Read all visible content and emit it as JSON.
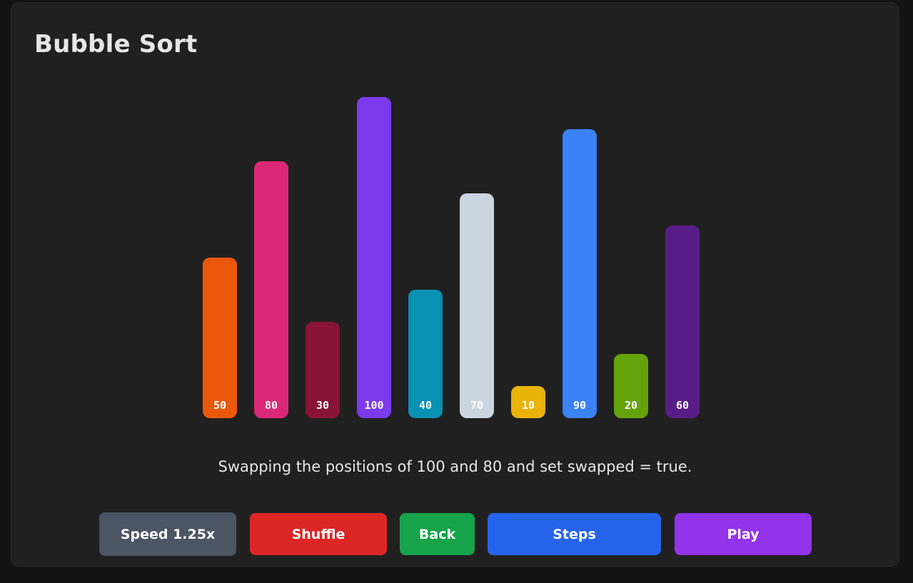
{
  "app": {
    "title": "Bubble Sort"
  },
  "chart_data": {
    "type": "bar",
    "categories": [
      "50",
      "80",
      "30",
      "100",
      "40",
      "70",
      "10",
      "90",
      "20",
      "60"
    ],
    "values": [
      50,
      80,
      30,
      100,
      40,
      70,
      10,
      90,
      20,
      60
    ],
    "colors": [
      "#ea580c",
      "#db2777",
      "#881337",
      "#7c3aed",
      "#0891b2",
      "#cbd5e1",
      "#eab308",
      "#3b82f6",
      "#65a30d",
      "#581c87"
    ],
    "ylim": [
      0,
      100
    ],
    "title": "",
    "xlabel": "",
    "ylabel": ""
  },
  "status": {
    "message": "Swapping the positions of 100 and 80 and set swapped = true."
  },
  "controls": {
    "speed_label": "Speed 1.25x",
    "shuffle_label": "Shuffle",
    "back_label": "Back",
    "steps_label": "Steps",
    "play_label": "Play"
  }
}
